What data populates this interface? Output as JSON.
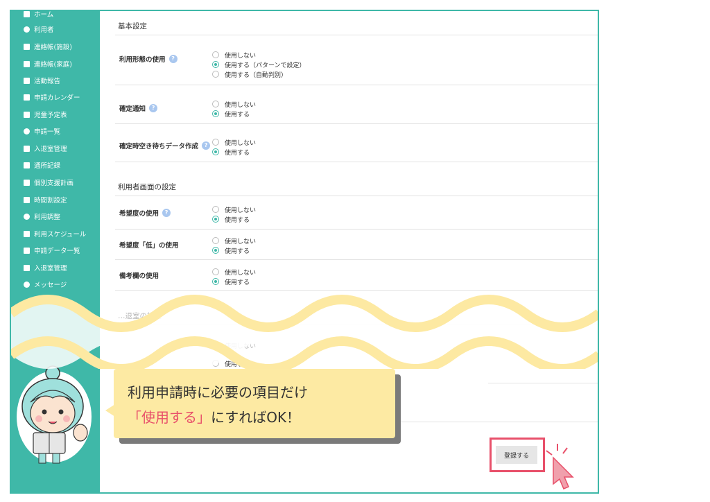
{
  "sidebar": {
    "items": [
      {
        "label": "ホーム",
        "icon": "home-icon"
      },
      {
        "label": "利用者",
        "icon": "users-icon"
      },
      {
        "label": "連絡帳(施設)",
        "icon": "contact-book-icon"
      },
      {
        "label": "連絡帳(家庭)",
        "icon": "contact-book-icon"
      },
      {
        "label": "活動報告",
        "icon": "report-icon"
      },
      {
        "label": "申請カレンダー",
        "icon": "calendar-icon"
      },
      {
        "label": "児童予定表",
        "icon": "schedule-icon"
      },
      {
        "label": "申請一覧",
        "icon": "list-icon"
      },
      {
        "label": "入退室管理",
        "icon": "door-icon"
      },
      {
        "label": "通所記録",
        "icon": "record-icon"
      },
      {
        "label": "個別支援計画",
        "icon": "plan-icon"
      },
      {
        "label": "時間割設定",
        "icon": "timetable-icon"
      },
      {
        "label": "利用調整",
        "icon": "adjust-icon"
      },
      {
        "label": "利用スケジュール",
        "icon": "schedule-icon"
      },
      {
        "label": "申請データ一覧",
        "icon": "data-icon"
      },
      {
        "label": "入退室管理",
        "icon": "door-icon"
      },
      {
        "label": "メッセージ",
        "icon": "bell-icon"
      }
    ]
  },
  "sections": {
    "basic": "基本設定",
    "user_screen": "利用者画面の設定",
    "faded_section": "…退室の設定"
  },
  "settings": [
    {
      "label": "利用形態の使用",
      "help": "?",
      "options": [
        "使用しない",
        "使用する（パターンで設定）",
        "使用する（自動判別）"
      ],
      "selected": 1
    },
    {
      "label": "確定通知",
      "help": "?",
      "options": [
        "使用しない",
        "使用する"
      ],
      "selected": 1
    },
    {
      "label": "確定時空き待ちデータ作成",
      "help": "?",
      "options": [
        "使用しない",
        "使用する"
      ],
      "selected": 1
    },
    {
      "label": "希望度の使用",
      "help": "?",
      "options": [
        "使用しない",
        "使用する"
      ],
      "selected": 1
    },
    {
      "label": "希望度「低」の使用",
      "help": "",
      "options": [
        "使用しない",
        "使用する"
      ],
      "selected": 1
    },
    {
      "label": "備考欄の使用",
      "help": "",
      "options": [
        "使用しない",
        "使用する"
      ],
      "selected": 1
    }
  ],
  "faded_options": [
    "使用しない",
    "使用しない"
  ],
  "save_button": "登録する",
  "callout": {
    "line1": "利用申請時に必要の項目だけ",
    "line2_highlight": "「使用する」",
    "line2_rest": "にすればOK！"
  },
  "colors": {
    "accent": "#3fb8a8",
    "highlight": "#e8506a",
    "bubble": "#fdeaa3",
    "help": "#a9c7ef"
  }
}
